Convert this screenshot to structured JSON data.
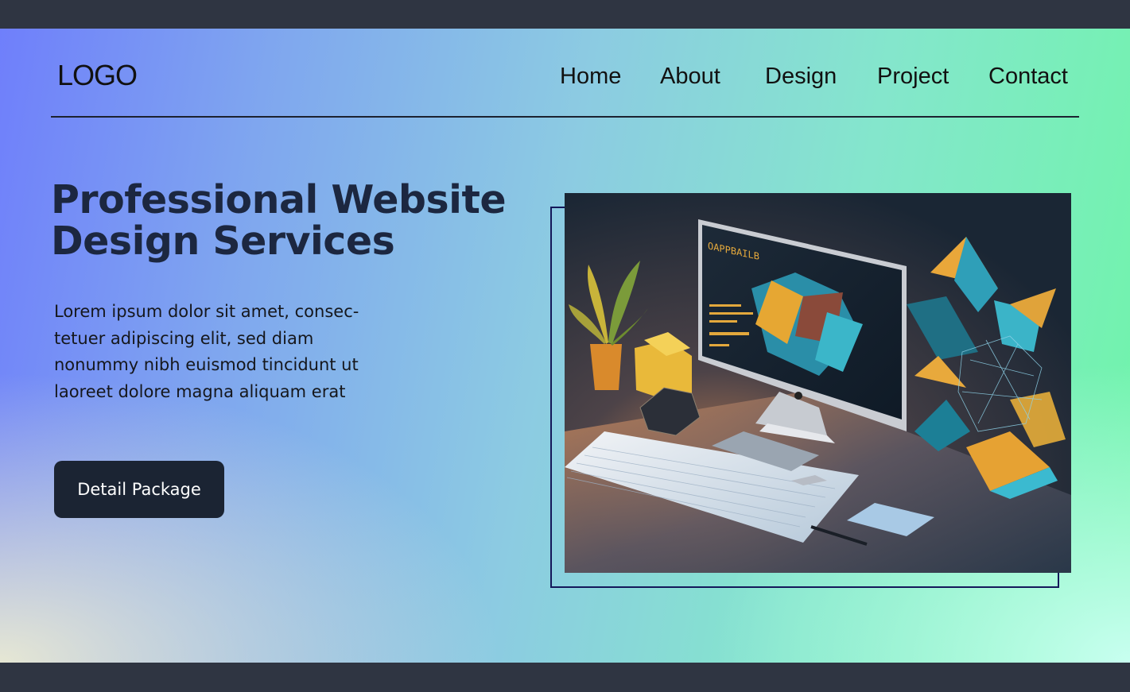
{
  "header": {
    "logo": "LOGO",
    "nav": [
      {
        "label": "Home"
      },
      {
        "label": "About"
      },
      {
        "label": "Design"
      },
      {
        "label": "Project"
      },
      {
        "label": "Contact"
      }
    ]
  },
  "hero": {
    "title_line1": "Professional Website",
    "title_line2": "Design Services",
    "description": "Lorem ipsum dolor sit amet, consec-tetuer adipiscing elit, sed diam nonummy nibh euismod tincidunt ut laoreet dolore magna aliquam erat",
    "cta_label": "Detail Package",
    "image_screen_text": "OAPPBAILB"
  },
  "colors": {
    "gradient_start": "#6f7ffb",
    "gradient_end": "#6ff5a9",
    "button_bg": "#1b2433",
    "headline": "#1c2740",
    "frame": "#14185a",
    "bars": "#2f3542"
  }
}
